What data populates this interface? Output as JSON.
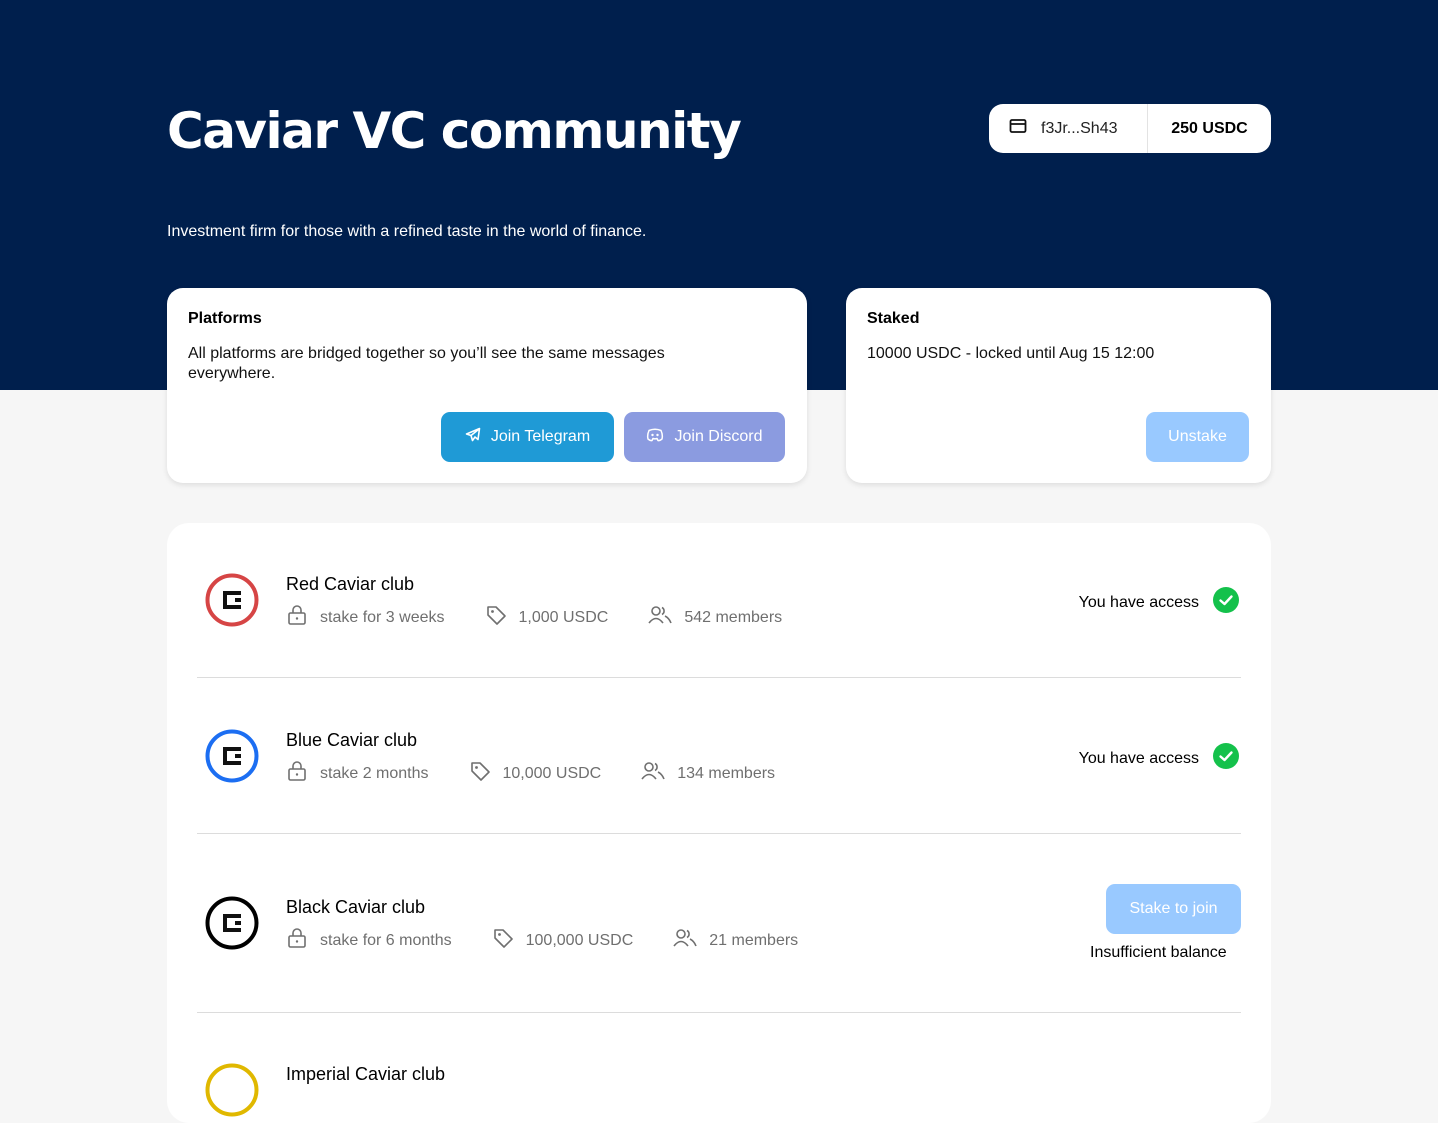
{
  "header": {
    "title": "Caviar VC community",
    "subtitle": "Investment firm for those with a refined taste in the world of finance.",
    "wallet_address": "f3Jr...Sh43",
    "wallet_balance": "250 USDC"
  },
  "platforms": {
    "heading": "Platforms",
    "description": "All platforms are bridged together so you’ll see the same messages everywhere.",
    "telegram_label": "Join Telegram",
    "discord_label": "Join Discord"
  },
  "staked": {
    "heading": "Staked",
    "description": "10000 USDC - locked until Aug 15 12:00",
    "unstake_label": "Unstake"
  },
  "clubs": [
    {
      "name": "Red Caviar club",
      "stake": "stake for 3 weeks",
      "price": "1,000 USDC",
      "members": "542 members",
      "status": "You have access",
      "color": "#d64545"
    },
    {
      "name": "Blue Caviar club",
      "stake": "stake 2 months",
      "price": "10,000 USDC",
      "members": "134 members",
      "status": "You have access",
      "color": "#1c6ef2"
    },
    {
      "name": "Black Caviar club",
      "stake": "stake for 6 months",
      "price": "100,000 USDC",
      "members": "21 members",
      "action_label": "Stake to join",
      "status": "Insufficient balance",
      "color": "#000000"
    },
    {
      "name": "Imperial Caviar club",
      "color": "#e0b800"
    }
  ],
  "colors": {
    "hero_bg": "#001f4d",
    "check_green": "#14c14b",
    "telegram": "#1f9ad6",
    "discord": "#8b9be0",
    "disabled_blue": "#99c9ff"
  },
  "icons": [
    "wallet-icon",
    "telegram-icon",
    "discord-icon",
    "lock-icon",
    "tag-icon",
    "members-icon",
    "check-icon"
  ]
}
